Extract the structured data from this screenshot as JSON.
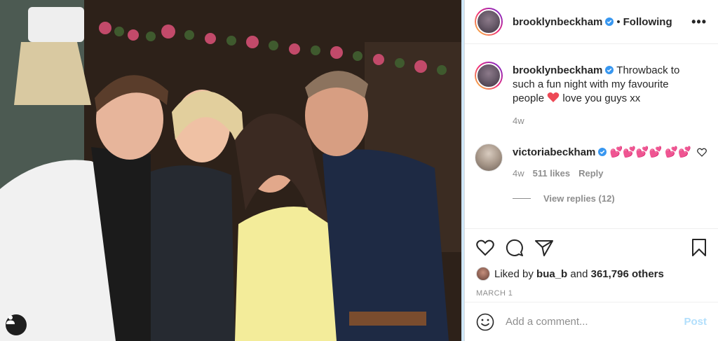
{
  "header": {
    "username": "brooklynbeckham",
    "separator": "•",
    "follow_state": "Following",
    "more": "•••"
  },
  "caption": {
    "username": "brooklynbeckham",
    "text_before_heart": "Throwback to such a fun night with my favourite people",
    "text_after_heart": "love you guys xx",
    "age": "4w"
  },
  "comment": {
    "username": "victoriabeckham",
    "emoji": "💕💕💕💕 💕💕",
    "age": "4w",
    "likes": "511 likes",
    "reply": "Reply",
    "view_replies": "View replies (12)"
  },
  "likes": {
    "prefix": "Liked by",
    "first_user": "bua_b",
    "conjunction": "and",
    "others": "361,796 others"
  },
  "date": "MARCH 1",
  "add_comment": {
    "placeholder": "Add a comment...",
    "post_label": "Post"
  },
  "colors": {
    "verified": "#3897f0",
    "heart": "#ed4956",
    "post_disabled": "#b2dffc"
  }
}
